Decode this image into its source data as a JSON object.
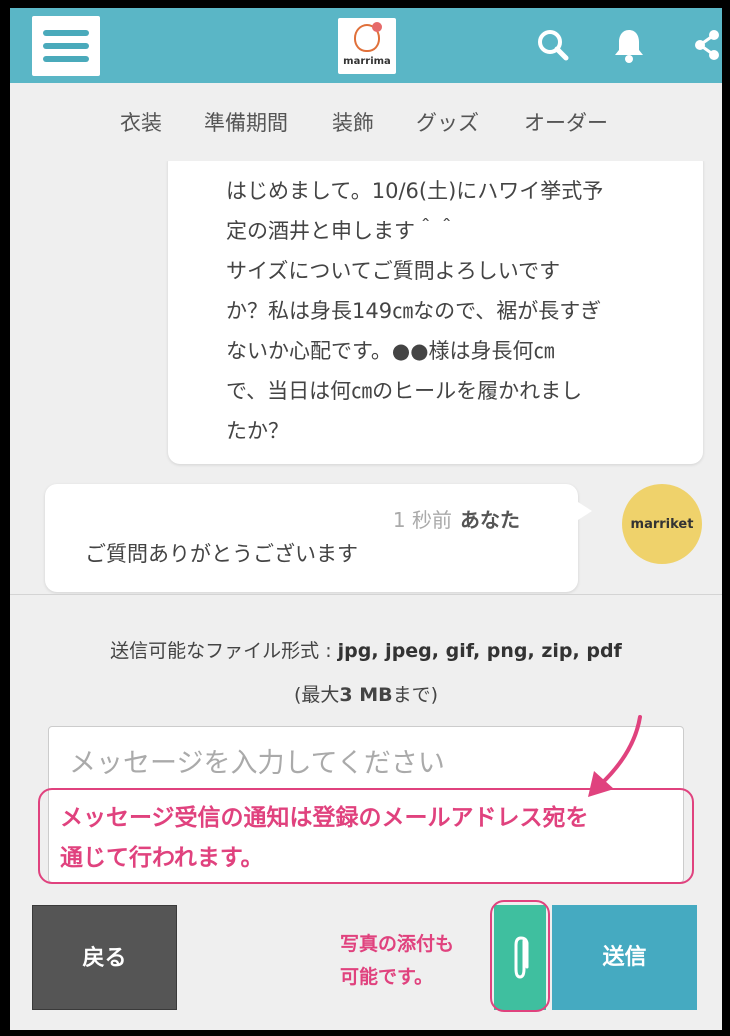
{
  "header": {
    "logo_text": "marrima",
    "icons": [
      "menu-icon",
      "search-icon",
      "bell-icon",
      "share-icon"
    ]
  },
  "nav": {
    "items": [
      "衣装",
      "準備期間",
      "装飾",
      "グッズ",
      "オーダー"
    ]
  },
  "chat": {
    "incoming": {
      "lines": [
        "はじめまして。10/6(土)にハワイ挙式予",
        "定の酒井と申します＾＾",
        "サイズについてご質問よろしいです",
        "か？私は身長149㎝なので、裾が長すぎ",
        "ないか心配です。●●様は身長何㎝",
        "で、当日は何㎝のヒールを履かれまし",
        "たか？"
      ]
    },
    "outgoing": {
      "time": "1 秒前",
      "sender": "あなた",
      "text": "ご質問ありがとうございます",
      "avatar_text": "marriket"
    }
  },
  "upload": {
    "formats_label": "送信可能なファイル形式 : ",
    "formats": "jpg, jpeg, gif, png, zip, pdf",
    "max_prefix": "(最大",
    "max_size": "3 MB",
    "max_suffix": "まで)"
  },
  "message_input": {
    "placeholder": "メッセージを入力してください"
  },
  "annotations": {
    "notification_line1": "メッセージ受信の通知は登録のメールアドレス宛を",
    "notification_line2": "通じて行われます。",
    "photo_line1": "写真の添付も",
    "photo_line2": "可能です。",
    "color": "#e0427e"
  },
  "actions": {
    "back_label": "戻る",
    "send_label": "送信"
  },
  "colors": {
    "header": "#5ab6c6",
    "send": "#45aac1",
    "attach": "#3fbf9f",
    "back": "#555555"
  }
}
